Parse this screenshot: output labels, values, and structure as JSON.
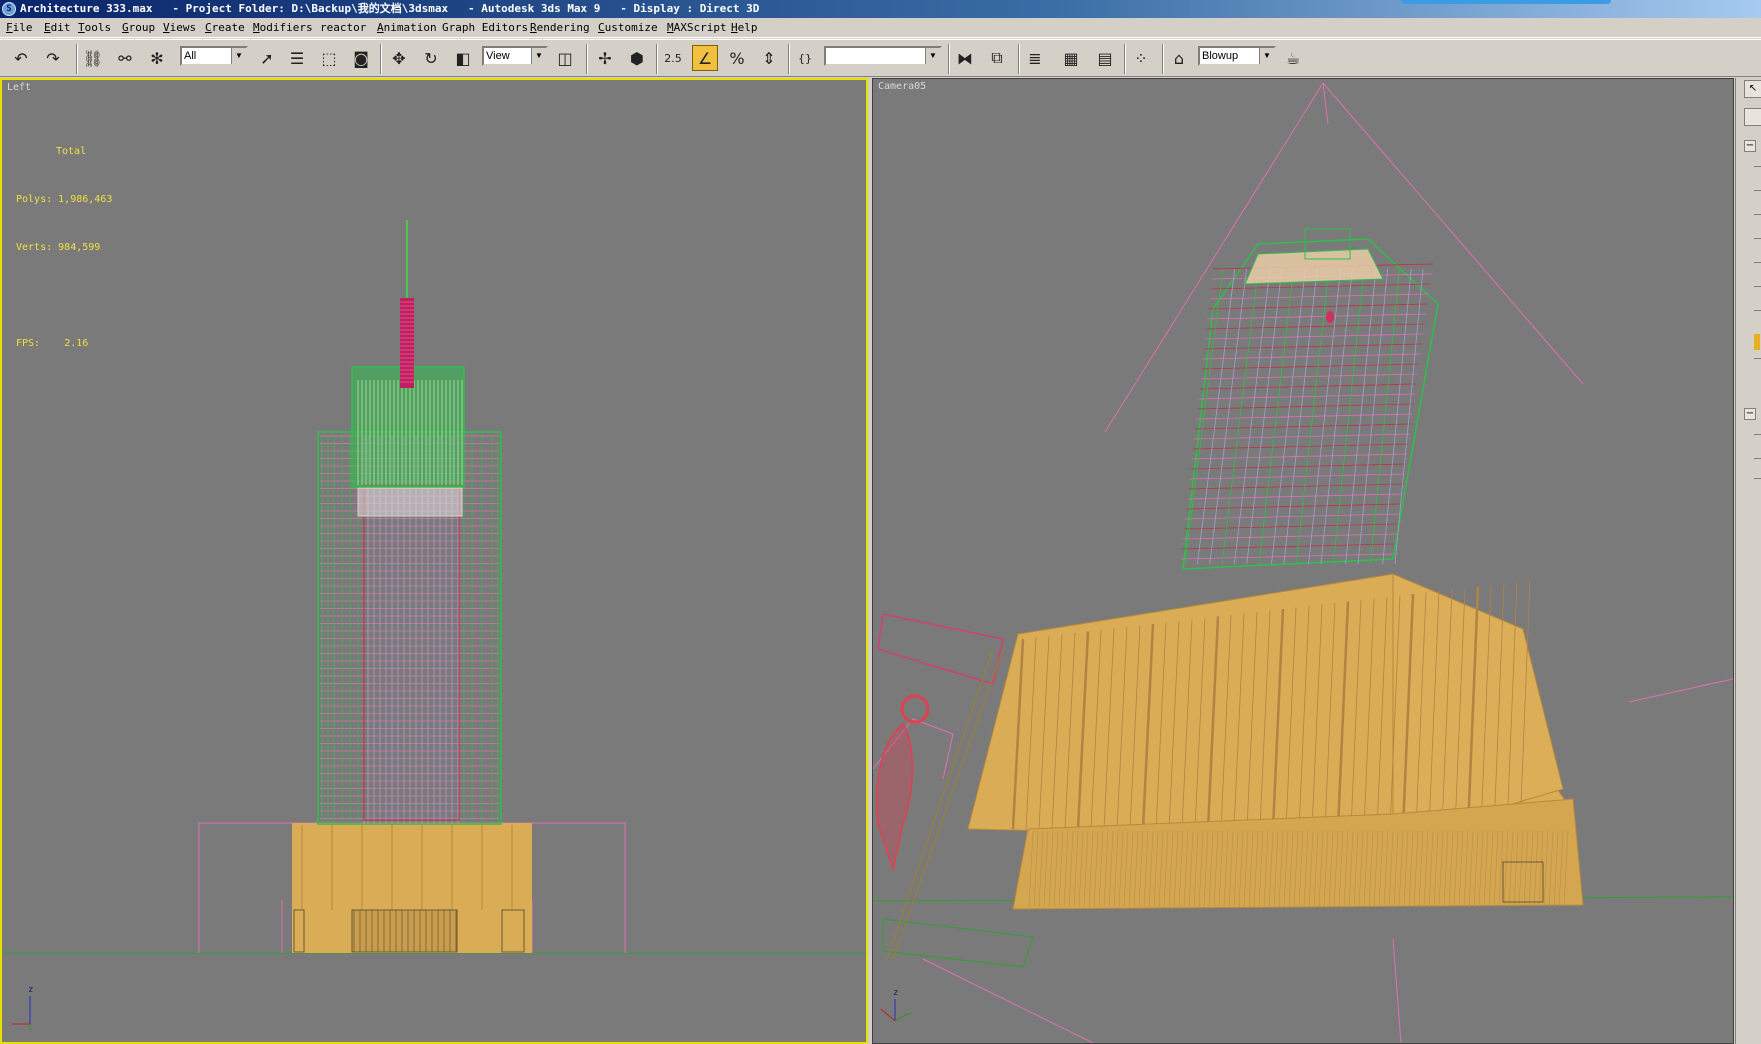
{
  "window": {
    "title": "Architecture 333.max   - Project Folder: D:\\Backup\\我的文档\\3dsmax   - Autodesk 3ds Max 9   - Display : Direct 3D"
  },
  "menu": [
    {
      "label": "File",
      "hot": "F"
    },
    {
      "label": "Edit",
      "hot": "E"
    },
    {
      "label": "Tools",
      "hot": "T"
    },
    {
      "label": "Group",
      "hot": "G"
    },
    {
      "label": "Views",
      "hot": "V"
    },
    {
      "label": "Create",
      "hot": "C"
    },
    {
      "label": "Modifiers",
      "hot": "M"
    },
    {
      "label": "reactor",
      "hot": ""
    },
    {
      "label": "Animation",
      "hot": "A"
    },
    {
      "label": "Graph Editors",
      "hot": ""
    },
    {
      "label": "Rendering",
      "hot": "R"
    },
    {
      "label": "Customize",
      "hot": "C"
    },
    {
      "label": "MAXScript",
      "hot": "M"
    },
    {
      "label": "Help",
      "hot": "H"
    }
  ],
  "toolbar": {
    "selection_filter": "All",
    "reference_coord": "View",
    "named_selection": "",
    "render_type": "Blowup",
    "snap_label": "2.5",
    "icons": [
      "undo-icon",
      "redo-icon",
      "select-link-icon",
      "unlink-icon",
      "bind-spacewarp-icon",
      "select-object-icon",
      "select-by-name-icon",
      "rect-region-icon",
      "window-crossing-icon",
      "move-icon",
      "rotate-icon",
      "scale-icon",
      "pivot-icon",
      "manipulate-icon",
      "keyboard-shortcut-icon",
      "snap-icon",
      "angle-snap-icon",
      "percent-snap-icon",
      "spinner-snap-icon",
      "edit-named-sel-icon",
      "mirror-icon",
      "align-icon",
      "layer-manager-icon",
      "curve-editor-icon",
      "schematic-view-icon",
      "material-editor-icon",
      "render-scene-icon",
      "quick-render-icon"
    ]
  },
  "viewports": {
    "left": {
      "label": "Left",
      "stats": {
        "header": "Total",
        "polys_label": "Polys:",
        "polys": "1,986,463",
        "verts_label": "Verts:",
        "verts": "984,599",
        "fps_label": "FPS:",
        "fps": "2.16"
      },
      "axis": {
        "z": "z",
        "x": "x",
        "y": "y"
      }
    },
    "right": {
      "label": "Camera05",
      "axis": {
        "z": "z",
        "x": "x",
        "y": "y"
      }
    }
  },
  "colors": {
    "viewport_bg": "#7a7a7a",
    "active_border": "#e8e000",
    "wire_green": "#2fbf4a",
    "wire_pink": "#e070b0",
    "wire_red": "#c03040",
    "base_orange": "#d9ac55",
    "stats_yellow": "#f0e040"
  }
}
